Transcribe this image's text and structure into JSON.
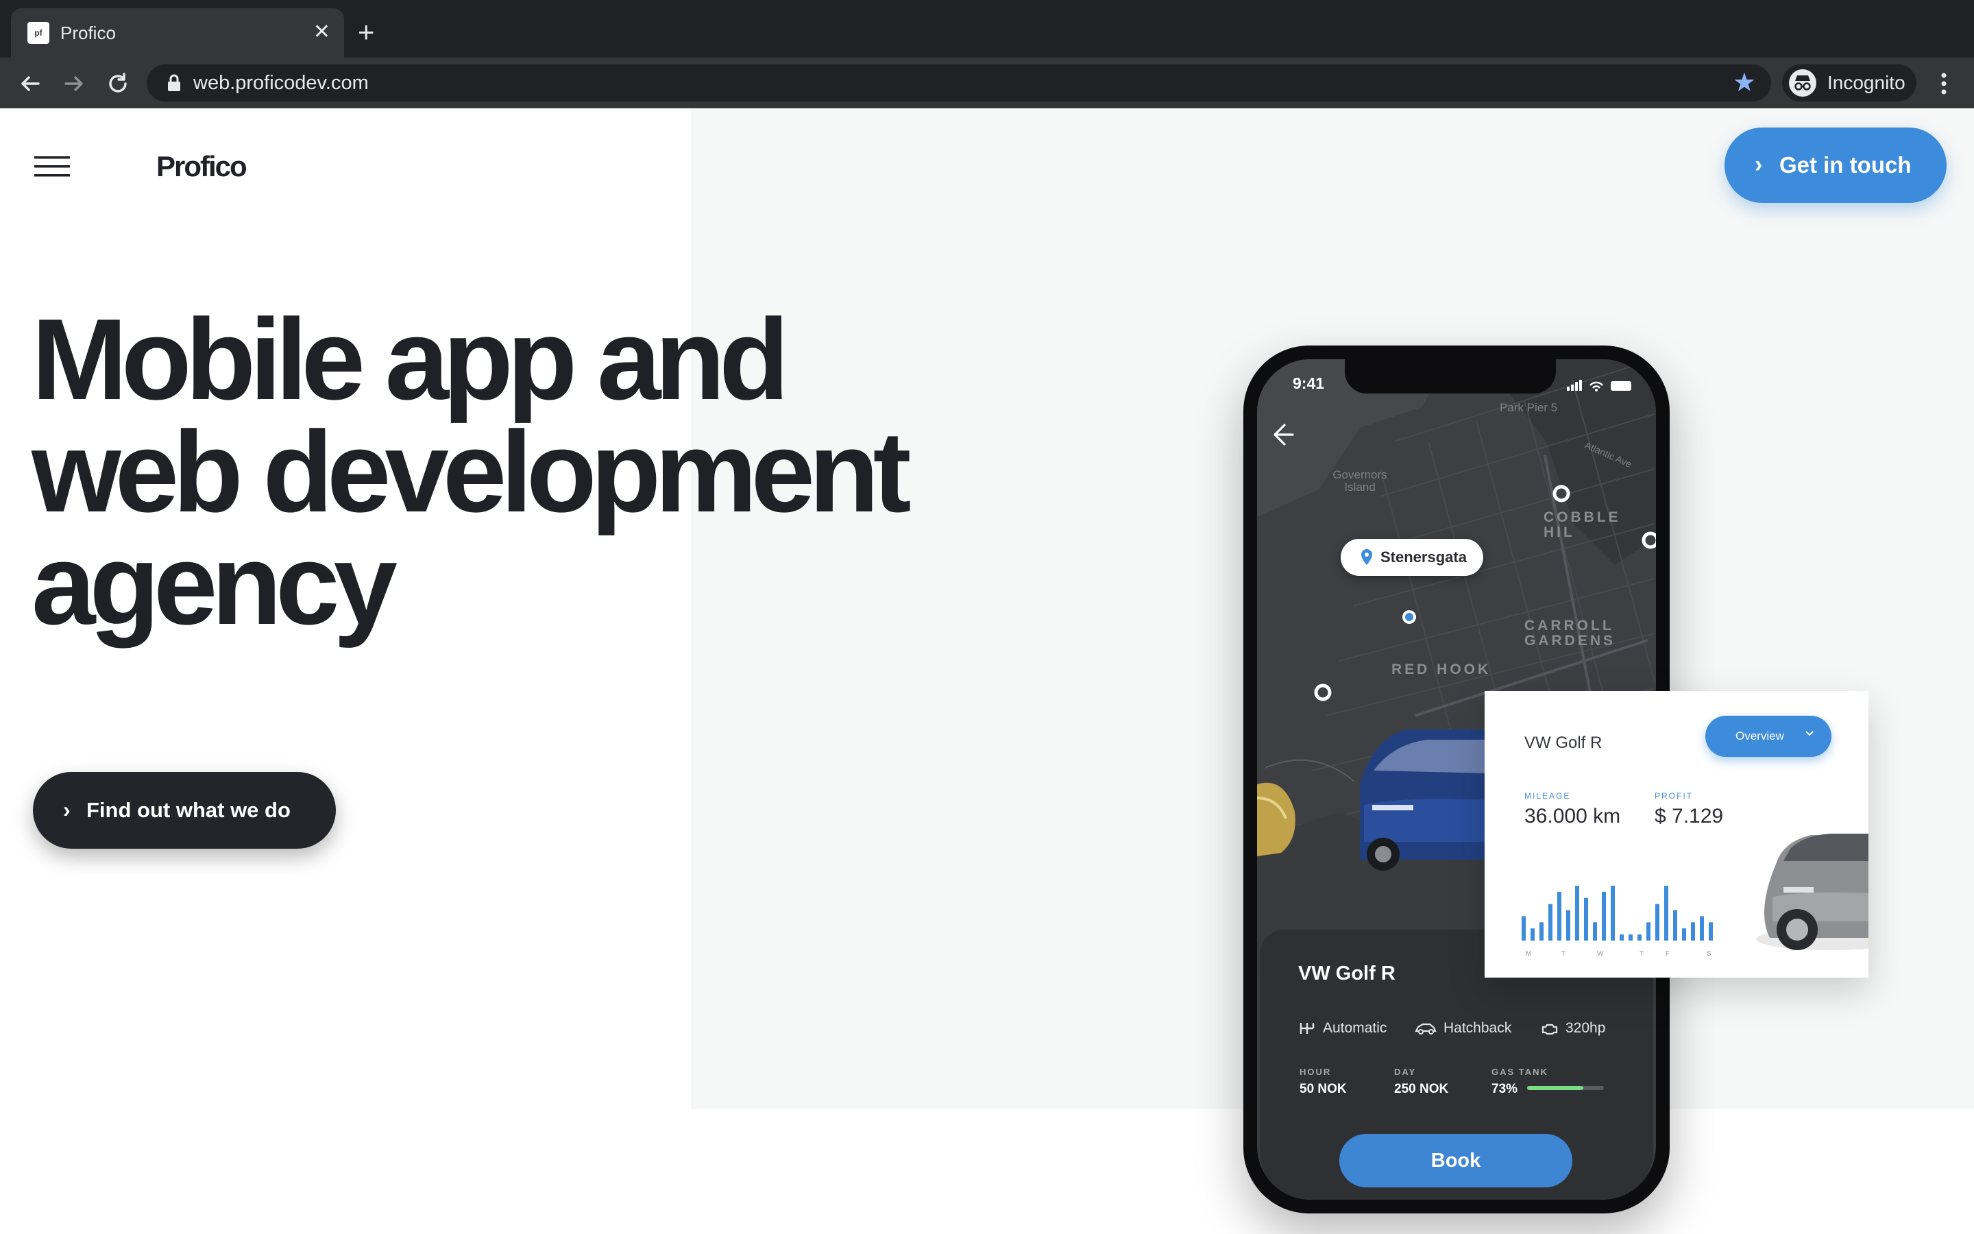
{
  "browser": {
    "tab_title": "Profico",
    "favicon_text": "pf",
    "url": "web.proficodev.com",
    "profile_label": "Incognito"
  },
  "site": {
    "logo": "Profico",
    "cta_top": "Get in touch",
    "headline_lines": [
      "Mobile app and",
      "web development",
      "agency"
    ],
    "cta_main": "Find out what we do"
  },
  "phone": {
    "time": "9:41",
    "pin_label": "Stenersgata",
    "map_labels": {
      "red_hook": "RED HOOK",
      "carroll_1": "CARROLL",
      "carroll_2": "GARDENS",
      "cobble": "COBBLE HIL",
      "governors_1": "Governors",
      "governors_2": "Island",
      "park_pier": "Park Pier 5",
      "atlantic": "Atlantic Ave"
    },
    "car_title": "VW Golf R",
    "specs": [
      "Automatic",
      "Hatchback",
      "320hp"
    ],
    "stats": [
      {
        "key": "HOUR",
        "value": "50 NOK"
      },
      {
        "key": "DAY",
        "value": "250 NOK"
      },
      {
        "key": "GAS TANK",
        "value": "73%"
      }
    ],
    "gas_level_percent": 73,
    "book_label": "Book"
  },
  "overview_card": {
    "title": "VW Golf R",
    "button_label": "Overview",
    "mileage_key": "MILEAGE",
    "mileage_value": "36.000 km",
    "profit_key": "PROFIT",
    "profit_value": "$ 7.129",
    "bar_values": [
      4,
      2,
      3,
      6,
      8,
      5,
      9,
      7,
      3,
      8,
      9,
      1,
      1,
      1,
      3,
      6,
      9,
      5,
      2,
      3,
      4,
      3
    ],
    "day_labels": [
      "M",
      "T",
      "W",
      "T",
      "F",
      "S"
    ]
  },
  "colors": {
    "accent_blue": "#3d8bdb",
    "dark": "#23252b",
    "hero_bg": "#f6f8f7"
  }
}
